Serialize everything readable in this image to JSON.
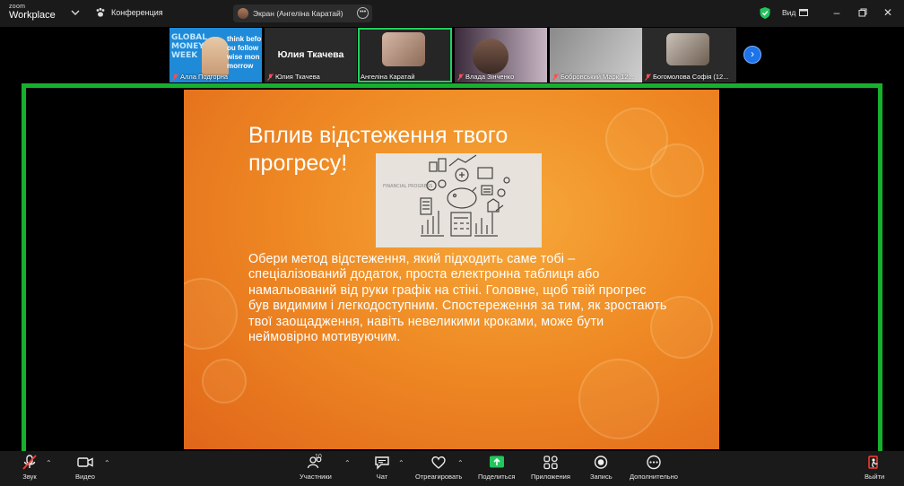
{
  "app": {
    "logo_top": "zoom",
    "logo_bottom": "Workplace",
    "meeting_label": "Конференция",
    "screen_share_label": "Экран (Ангеліна Каратай)",
    "view_label": "Вид",
    "window_controls": [
      "minimize",
      "restore",
      "close"
    ]
  },
  "participants": [
    {
      "name": "Алла Подгорна",
      "tile": "money",
      "mic": "muted",
      "tile_text_left": "GLOBAL\nMONEY\nWEEK",
      "tile_text_right": "think befo\nou follow\nwise mon\nmorrow"
    },
    {
      "name": "Юлия Ткачева",
      "tile": "name-only",
      "mic": "muted",
      "big_name": "Юлия Ткачева"
    },
    {
      "name": "Ангеліна Каратай",
      "tile": "video",
      "mic": "on",
      "active_speaker": true
    },
    {
      "name": "Влада Зінченко",
      "tile": "video",
      "mic": "muted"
    },
    {
      "name": "Бобровський Марк 12...",
      "tile": "video",
      "mic": "muted"
    },
    {
      "name": "Богомолова Софія (12...",
      "tile": "video",
      "mic": "muted"
    }
  ],
  "slide": {
    "title": "Вплив відстеження твого прогресу!",
    "image_caption": "FINANCIAL PROGRESS",
    "body": "Обери метод відстеження, який підходить саме тобі – спеціалізований додаток, проста електронна таблиця або намальований від руки графік на стіні. Головне, щоб твій прогрес був видимим і легкодоступним. Спостереження за тим, як зростають твої заощадження, навіть невеликими кроками, може бути неймовірно мотивуючим."
  },
  "toolbar": {
    "audio_label": "Звук",
    "video_label": "Видео",
    "participants_label": "Участники",
    "participants_count": "10",
    "chat_label": "Чат",
    "react_label": "Отреагировать",
    "share_label": "Поделиться",
    "apps_label": "Приложения",
    "record_label": "Запись",
    "more_label": "Дополнительно",
    "leave_label": "Выйти"
  },
  "colors": {
    "active_border": "#17b02e",
    "share_button": "#22c55e",
    "next_button": "#1d73e8",
    "leave_icon": "#ff3b30",
    "slide_orange": "#ef8a24"
  }
}
